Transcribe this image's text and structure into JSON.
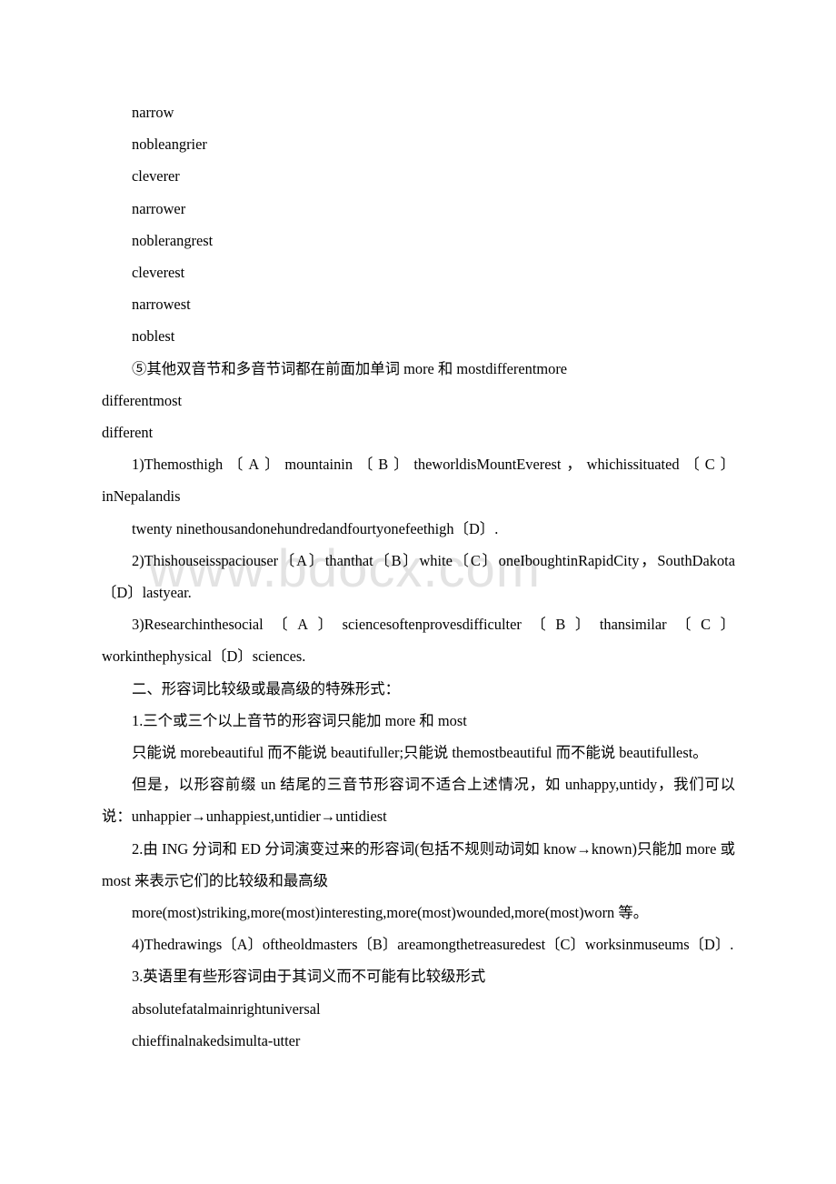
{
  "document": {
    "watermark": "www.bdocx.com",
    "blocks": [
      {
        "id": "w-narrow",
        "style": "word",
        "text": "narrow"
      },
      {
        "id": "w-nobleangrier",
        "style": "word",
        "text": "nobleangrier"
      },
      {
        "id": "w-cleverer",
        "style": "word",
        "text": "cleverer"
      },
      {
        "id": "w-narrower",
        "style": "word",
        "text": "narrower"
      },
      {
        "id": "w-noblerangrest",
        "style": "word",
        "text": "noblerangrest"
      },
      {
        "id": "w-cleverest",
        "style": "word",
        "text": "cleverest"
      },
      {
        "id": "w-narrowest",
        "style": "word",
        "text": "narrowest"
      },
      {
        "id": "w-noblest",
        "style": "word",
        "text": "noblest"
      },
      {
        "id": "rule-5",
        "style": "indent",
        "text": "⑤其他双音节和多音节词都在前面加单词 more 和 mostdifferentmore"
      },
      {
        "id": "w-differentmost",
        "style": "noindent",
        "text": "differentmost"
      },
      {
        "id": "w-different",
        "style": "noindent",
        "text": "different"
      },
      {
        "id": "ex-1",
        "style": "indent",
        "text": "1)Themosthigh〔A〕mountainin〔B〕theworldisMountEverest，whichissituated〔C〕inNepalandis"
      },
      {
        "id": "ex-1-cont",
        "style": "indent",
        "text": "twenty ninethousandonehundredandfourtyonefeethigh〔D〕."
      },
      {
        "id": "ex-2",
        "style": "indent",
        "text": "2)Thishouseisspaciouser〔A〕thanthat〔B〕white〔C〕oneIboughtinRapidCity，SouthDakota〔D〕lastyear."
      },
      {
        "id": "ex-3",
        "style": "indent",
        "text": "3)Researchinthesocial〔A〕sciencesoftenprovesdifficulter〔B〕thansimilar〔C〕workinthephysical〔D〕sciences."
      },
      {
        "id": "heading-2",
        "style": "indent",
        "text": "二、形容词比较级或最高级的特殊形式："
      },
      {
        "id": "rule-1",
        "style": "indent",
        "text": "1.三个或三个以上音节的形容词只能加 more 和 most"
      },
      {
        "id": "rule-1-note",
        "style": "indent",
        "text": "只能说 morebeautiful 而不能说 beautifuller;只能说 themostbeautiful 而不能说 beautifullest。"
      },
      {
        "id": "rule-1-exc",
        "style": "indent",
        "text": "但是，以形容前缀 un 结尾的三音节形容词不适合上述情况，如 unhappy,untidy，我们可以说：unhappier→unhappiest,untidier→untidiest"
      },
      {
        "id": "rule-2",
        "style": "indent",
        "text": "2.由 ING 分词和 ED 分词演变过来的形容词(包括不规则动词如 know→known)只能加 more 或 most 来表示它们的比较级和最高级"
      },
      {
        "id": "rule-2-ex",
        "style": "indent",
        "text": "more(most)striking,more(most)interesting,more(most)wounded,more(most)worn 等。"
      },
      {
        "id": "ex-4",
        "style": "indent",
        "text": "4)Thedrawings〔A〕oftheoldmasters〔B〕areamongthetreasuredest〔C〕worksinmuseums〔D〕."
      },
      {
        "id": "rule-3",
        "style": "indent",
        "text": "3.英语里有些形容词由于其词义而不可能有比较级形式"
      },
      {
        "id": "rule-3-ex1",
        "style": "indent",
        "text": "absolutefatalmainrightuniversal"
      },
      {
        "id": "rule-3-ex2",
        "style": "indent",
        "text": "chieffinalnakedsimulta-utter"
      }
    ]
  }
}
